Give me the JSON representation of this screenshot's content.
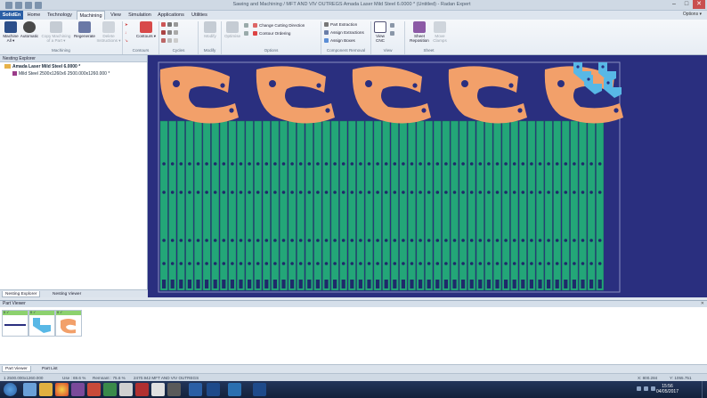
{
  "window": {
    "title": "Sawing and Machining / MFT AND VIV OUTREGS Amada Laser Mild Steel 6.0000 * (Untitled) - Radan Expert"
  },
  "menu": {
    "app_tab": "SolidEn",
    "tabs": [
      "Home",
      "Technology",
      "Machining",
      "View",
      "Simulation",
      "Applications",
      "Utilities"
    ],
    "active": "Machining",
    "options": "Options ▾"
  },
  "ribbon": {
    "machining": [
      {
        "label": "Machine All ▾",
        "enabled": true
      },
      {
        "label": "Automatic",
        "enabled": true
      },
      {
        "label": "Copy Machining of a Part ▾",
        "enabled": false
      },
      {
        "label": "Regenerate",
        "enabled": true
      },
      {
        "label": "Delete Instructions ▾",
        "enabled": false
      }
    ],
    "contours": {
      "label": "Contours ▾"
    },
    "modify": {
      "label": "Modify"
    },
    "cycles": {
      "label": "Optimise"
    },
    "options": [
      "Change Cutting Direction",
      "Contour Ordering"
    ],
    "removal": [
      "Part Extraction",
      "Assign Extractions",
      "Assign Boxes"
    ],
    "view": {
      "label": "View CNC"
    },
    "sheet": [
      {
        "label": "Sheet Reposition"
      },
      {
        "label": "Move Clamps"
      }
    ],
    "groups": [
      "Machining",
      "Contours",
      "Cycles",
      "Modify",
      "Options",
      "Component Removal",
      "View",
      "Sheet"
    ]
  },
  "explorer": {
    "title": "Nesting Explorer",
    "root": "Amada Laser Mild Steel 6.0000 *",
    "child": "Mild Steel 2500x1260x6 2500.000x1260.000 *",
    "tabs": [
      "Nesting Explorer",
      "Nesting Viewer"
    ]
  },
  "part_viewer": {
    "title": "Part Viewer",
    "close": "✕",
    "cards": [
      {
        "tag": "0 ✓"
      },
      {
        "tag": "0 ✓"
      },
      {
        "tag": "0 ✓"
      }
    ],
    "tabs": [
      "Part Viewer",
      "Part List"
    ]
  },
  "status": {
    "left": "1  2500.000x1260.000",
    "use": "Use : 69.6 %",
    "remnant": "Remnant : 75.6 %",
    "mode": "2470.942  MFT AND VIV OUTREGS",
    "coords": "X: 800.284",
    "coords_y": "Y: 1055.751"
  },
  "taskbar": {
    "time": "15:56",
    "date": "04/05/2017"
  },
  "colors": {
    "sheet": "#2a2f7f",
    "strip": "#23a678",
    "hook": "#f2a06a",
    "bracket": "#58b8e6",
    "hole": "#1e2a6a"
  }
}
